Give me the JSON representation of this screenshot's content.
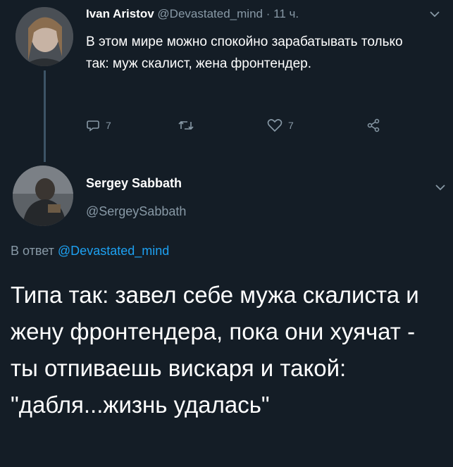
{
  "tweet1": {
    "name": "Ivan Aristov",
    "handle": "@Devastated_mind",
    "separator": "·",
    "time": "11 ч.",
    "text": "В этом мире можно спокойно зарабатывать только так: муж скалист, жена фронтендер.",
    "reply_count": "7",
    "like_count": "7"
  },
  "tweet2": {
    "name": "Sergey Sabbath",
    "handle": "@SergeySabbath",
    "reply_prefix": "В ответ",
    "reply_handle": "@Devastated_mind",
    "text": "Типа так: завел себе мужа скалиста и жену фронтендера, пока они хуячат - ты отпиваешь вискаря и такой: \"дабля...жизнь удалась\""
  },
  "colors": {
    "background": "#141d26",
    "muted": "#8899a6",
    "link": "#1da1f2"
  }
}
